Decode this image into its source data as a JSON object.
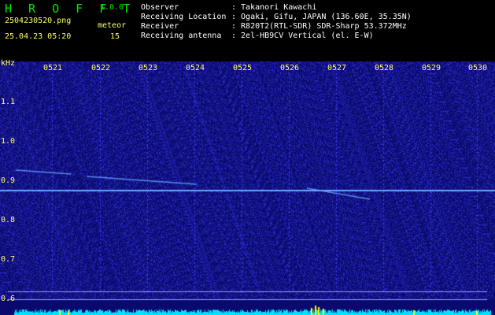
{
  "app": {
    "name": "H R O F F T",
    "version": "1.0.0"
  },
  "file": {
    "name": "2504230520.png",
    "datetime": "25.04.23 05:20"
  },
  "meteor": {
    "label": "meteor",
    "count": "15"
  },
  "info": [
    {
      "label": "Observer",
      "value": ": Takanori Kawachi"
    },
    {
      "label": "Receiving Location",
      "value": ": Ogaki, Gifu, JAPAN (136.60E, 35.35N)"
    },
    {
      "label": "Receiver",
      "value": ": R820T2(RTL-SDR) SDR-Sharp 53.372MHz"
    },
    {
      "label": "Receiving antenna",
      "value": ": 2el-HB9CV Vertical (el. E-W)"
    }
  ],
  "axis": {
    "y_unit": "kHz",
    "x_ticks": [
      "0521",
      "0522",
      "0523",
      "0524",
      "0525",
      "0526",
      "0527",
      "0528",
      "0529",
      "0530"
    ],
    "y_ticks": [
      "1.1",
      "1.0",
      "0.9",
      "0.8",
      "0.7",
      "0.6"
    ]
  },
  "colors": {
    "background": "#0a0a6e",
    "noise": "#2a2acc",
    "carrier": "#66aaff",
    "grid": "#3c3cff",
    "header_text_green": "#00e600",
    "header_text_yellow": "#ffff66",
    "trace_cyan": "#00e0ff",
    "trace_yellow": "#ffff00"
  }
}
